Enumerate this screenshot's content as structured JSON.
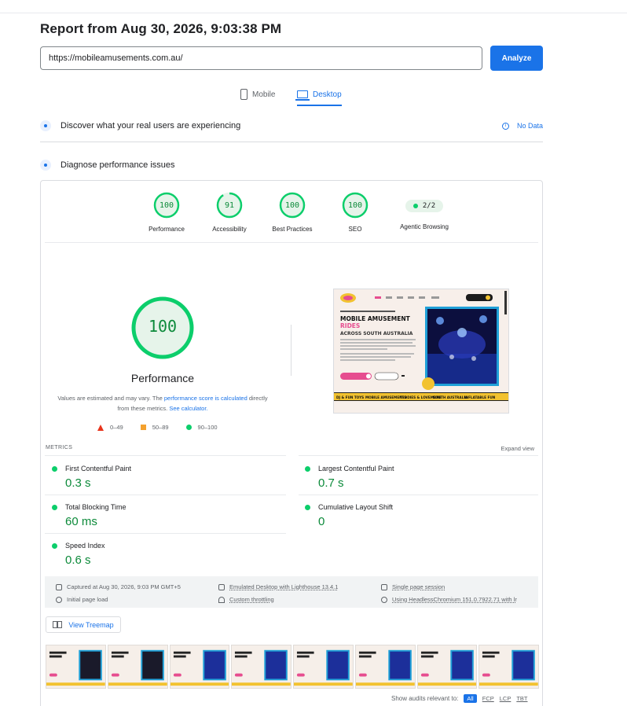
{
  "report": {
    "title": "Report from Aug 30, 2026, 9:03:38 PM"
  },
  "url_form": {
    "url_value": "https://mobileamusements.com.au/",
    "analyze_label": "Analyze"
  },
  "tabs": [
    {
      "label": "Mobile",
      "icon": "phone-icon",
      "active": false
    },
    {
      "label": "Desktop",
      "icon": "laptop-icon",
      "active": true
    }
  ],
  "field_data": {
    "label": "Discover what your real users are experiencing",
    "status": "No Data"
  },
  "diagnose": {
    "label": "Diagnose performance issues"
  },
  "categories": [
    {
      "name": "Performance",
      "score": "100",
      "score_value": 100
    },
    {
      "name": "Accessibility",
      "score": "91",
      "score_value": 91
    },
    {
      "name": "Best Practices",
      "score": "100",
      "score_value": 100
    },
    {
      "name": "SEO",
      "score": "100",
      "score_value": 100
    }
  ],
  "agentic": {
    "name": "Agentic Browsing",
    "score": "2/2"
  },
  "performance": {
    "score": "100",
    "score_value": 100,
    "label": "Performance",
    "disclaimer_pre": "Values are estimated and may vary. The ",
    "disclaimer_link1": "performance score is calculated",
    "disclaimer_mid": " directly from these metrics. ",
    "disclaimer_link2": "See calculator."
  },
  "legend": {
    "poor": "0–49",
    "average": "50–89",
    "good": "90–100"
  },
  "screenshot": {
    "headline1": "MOBILE AMUSEMENT",
    "headline2": "RIDES",
    "headline3": "ACROSS SOUTH AUSTRALIA",
    "ticker": [
      "DJ & FUN TOYS",
      "MOBILE AMUSEMENTS",
      "TEDDIES & LOVEMORE",
      "SOUTH AUSTRALIA",
      "INFLATABLE FUN"
    ]
  },
  "metrics": {
    "title": "METRICS",
    "expand_label": "Expand view",
    "items": [
      {
        "name": "First Contentful Paint",
        "value": "0.3 s"
      },
      {
        "name": "Largest Contentful Paint",
        "value": "0.7 s"
      },
      {
        "name": "Total Blocking Time",
        "value": "60 ms"
      },
      {
        "name": "Cumulative Layout Shift",
        "value": "0"
      },
      {
        "name": "Speed Index",
        "value": "0.6 s"
      }
    ]
  },
  "run_info": {
    "captured": "Captured at Aug 30, 2026, 9:03 PM GMT+5",
    "device": "Emulated Desktop with Lighthouse 13.4.1",
    "session": "Single page session",
    "load": "Initial page load",
    "throttling": "Custom throttling",
    "browser": "Using HeadlessChromium 151.0.7922.71 with lr"
  },
  "treemap": {
    "label": "View Treemap"
  },
  "audits_filter": {
    "label": "Show audits relevant to:",
    "options": [
      "All",
      "FCP",
      "LCP",
      "TBT"
    ]
  },
  "colors": {
    "good": "#0cce6b",
    "good_text": "#0c8a3a",
    "average": "#f4a12e",
    "poor": "#e8341c",
    "accent": "#1a73e8"
  }
}
